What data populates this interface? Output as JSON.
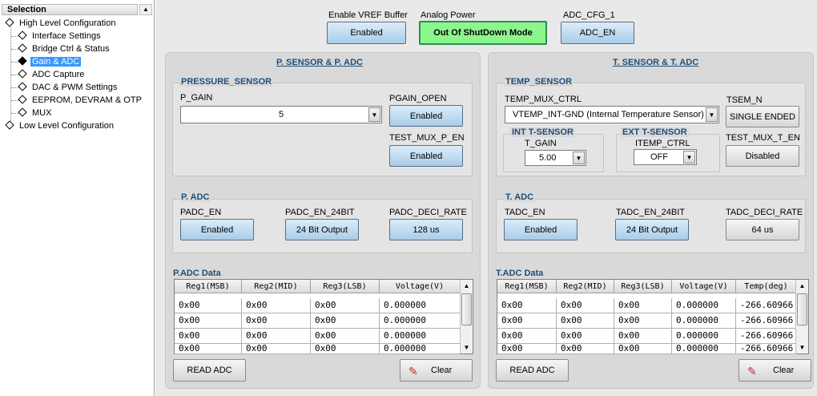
{
  "sidebar": {
    "header": "Selection",
    "items": [
      {
        "label": "High Level Configuration"
      },
      {
        "label": "Interface Settings"
      },
      {
        "label": "Bridge Ctrl & Status"
      },
      {
        "label": "Gain & ADC"
      },
      {
        "label": "ADC Capture"
      },
      {
        "label": "DAC & PWM Settings"
      },
      {
        "label": "EEPROM, DEVRAM & OTP"
      },
      {
        "label": "MUX"
      },
      {
        "label": "Low Level Configuration"
      }
    ]
  },
  "top": {
    "vref_label": "Enable VREF Buffer",
    "vref_value": "Enabled",
    "analog_label": "Analog Power",
    "analog_value": "Out Of ShutDown Mode",
    "adc_cfg_label": "ADC_CFG_1",
    "adc_cfg_value": "ADC_EN"
  },
  "pressure": {
    "title": "P. SENSOR & P. ADC",
    "sensor_group": "PRESSURE_SENSOR",
    "p_gain_label": "P_GAIN",
    "p_gain_value": "5",
    "pgain_open_label": "PGAIN_OPEN",
    "pgain_open_value": "Enabled",
    "test_mux_label": "TEST_MUX_P_EN",
    "test_mux_value": "Enabled",
    "adc_group": "P. ADC",
    "padc_en_label": "PADC_EN",
    "padc_en_value": "Enabled",
    "padc_24_label": "PADC_EN_24BIT",
    "padc_24_value": "24 Bit Output",
    "padc_deci_label": "PADC_DECI_RATE",
    "padc_deci_value": "128 us",
    "data_title": "P.ADC Data",
    "columns": [
      "Reg1(MSB)",
      "Reg2(MID)",
      "Reg3(LSB)",
      "Voltage(V)"
    ],
    "rows": [
      [
        "0x00",
        "0x00",
        "0x00",
        "0.000000"
      ],
      [
        "0x00",
        "0x00",
        "0x00",
        "0.000000"
      ],
      [
        "0x00",
        "0x00",
        "0x00",
        "0.000000"
      ],
      [
        "0x00",
        "0x00",
        "0x00",
        "0.000000"
      ]
    ],
    "read_label": "READ ADC",
    "clear_label": "Clear"
  },
  "temp": {
    "title": "T. SENSOR & T. ADC",
    "sensor_group": "TEMP_SENSOR",
    "mux_label": "TEMP_MUX_CTRL",
    "mux_value": "VTEMP_INT-GND (Internal Temperature Sensor)",
    "tsem_label": "TSEM_N",
    "tsem_value": "SINGLE ENDED",
    "int_group": "INT T-SENSOR",
    "t_gain_label": "T_GAIN",
    "t_gain_value": "5.00",
    "ext_group": "EXT T-SENSOR",
    "itemp_label": "ITEMP_CTRL",
    "itemp_value": "OFF",
    "test_mux_label": "TEST_MUX_T_EN",
    "test_mux_value": "Disabled",
    "adc_group": "T. ADC",
    "tadc_en_label": "TADC_EN",
    "tadc_en_value": "Enabled",
    "tadc_24_label": "TADC_EN_24BIT",
    "tadc_24_value": "24 Bit Output",
    "tadc_deci_label": "TADC_DECI_RATE",
    "tadc_deci_value": "64 us",
    "data_title": "T.ADC Data",
    "columns": [
      "Reg1(MSB)",
      "Reg2(MID)",
      "Reg3(LSB)",
      "Voltage(V)",
      "Temp(deg)"
    ],
    "rows": [
      [
        "0x00",
        "0x00",
        "0x00",
        "0.000000",
        "-266.60966"
      ],
      [
        "0x00",
        "0x00",
        "0x00",
        "0.000000",
        "-266.60966"
      ],
      [
        "0x00",
        "0x00",
        "0x00",
        "0.000000",
        "-266.60966"
      ],
      [
        "0x00",
        "0x00",
        "0x00",
        "0.000000",
        "-266.60966"
      ]
    ],
    "read_label": "READ ADC",
    "clear_label": "Clear"
  }
}
